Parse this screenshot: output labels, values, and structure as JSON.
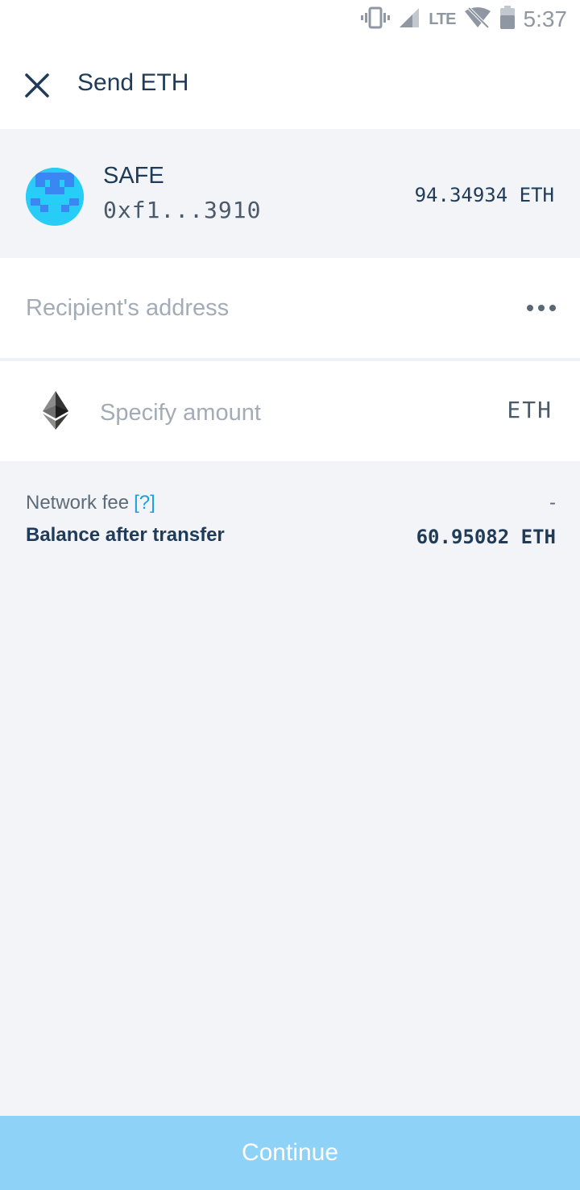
{
  "status_bar": {
    "time": "5:37",
    "network": "LTE",
    "icons": [
      "vibrate-icon",
      "signal-icon",
      "wifi-off-icon",
      "battery-icon"
    ]
  },
  "header": {
    "title": "Send ETH",
    "close_icon": "close-icon"
  },
  "account": {
    "name": "SAFE",
    "address": "0xf1...3910",
    "balance": "94.34934 ETH",
    "avatar_color": "#27cdf7"
  },
  "recipient": {
    "placeholder": "Recipient's address",
    "value": "",
    "more_icon": "more-horizontal-icon"
  },
  "amount": {
    "placeholder": "Specify amount",
    "value": "",
    "unit": "ETH",
    "token_icon": "ethereum-icon"
  },
  "fee": {
    "label": "Network fee",
    "help": "[?]",
    "value": "-"
  },
  "balance_after": {
    "label": "Balance after transfer",
    "value": "60.95082 ETH"
  },
  "footer": {
    "continue_label": "Continue",
    "button_color": "#8fd2f7"
  },
  "colors": {
    "background": "#f2f4f8",
    "text_primary": "#1f3b57",
    "link": "#1aa2e0"
  }
}
